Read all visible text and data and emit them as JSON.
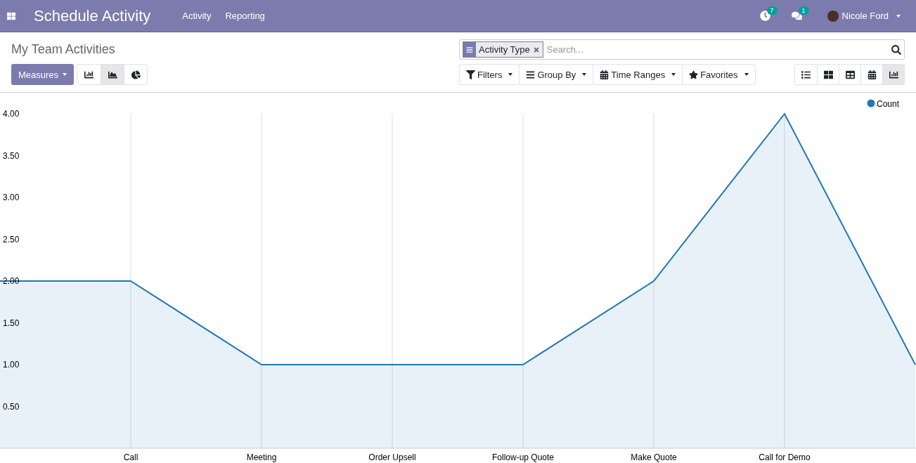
{
  "navbar": {
    "app_title": "Schedule Activity",
    "menu": [
      {
        "label": "Activity"
      },
      {
        "label": "Reporting"
      }
    ],
    "activity_count": "7",
    "message_count": "1",
    "user": "Nicole Ford"
  },
  "control_panel": {
    "title": "My Team Activities",
    "measures_button": "Measures",
    "chart_types": [
      {
        "kind": "bar",
        "selected": false
      },
      {
        "kind": "line",
        "selected": true
      },
      {
        "kind": "pie",
        "selected": false
      }
    ],
    "search": {
      "facets": [
        {
          "label": "Activity Type"
        }
      ],
      "placeholder": "Search..."
    },
    "search_options": [
      {
        "kind": "filter",
        "label": "Filters"
      },
      {
        "kind": "group",
        "label": "Group By"
      },
      {
        "kind": "time",
        "label": "Time Ranges"
      },
      {
        "kind": "favorite",
        "label": "Favorites"
      }
    ],
    "views": [
      {
        "kind": "list",
        "selected": false
      },
      {
        "kind": "kanban",
        "selected": false
      },
      {
        "kind": "pivot",
        "selected": false
      },
      {
        "kind": "calendar",
        "selected": false
      },
      {
        "kind": "graph",
        "selected": true
      }
    ]
  },
  "chart": {
    "chart_data": {
      "type": "area",
      "categories": [
        null,
        "Call",
        "Meeting",
        "Order Upsell",
        "Follow-up Quote",
        "Make Quote",
        "Call for Demo",
        null
      ],
      "series": [
        {
          "name": "Count",
          "color": "#1f77b4",
          "values": [
            2,
            2,
            1,
            1,
            1,
            2,
            4,
            1
          ]
        }
      ],
      "ylim": [
        0,
        4
      ],
      "grid": true,
      "yticks": [
        {
          "value": 0.5,
          "label": "0.50"
        },
        {
          "value": 1,
          "label": "1.00"
        },
        {
          "value": 1.5,
          "label": "1.50"
        },
        {
          "value": 2,
          "label": "2.00"
        },
        {
          "value": 2.5,
          "label": "2.50"
        },
        {
          "value": 3,
          "label": "3.00"
        },
        {
          "value": 3.5,
          "label": "3.50"
        },
        {
          "value": 4,
          "label": "4.00"
        }
      ]
    }
  }
}
